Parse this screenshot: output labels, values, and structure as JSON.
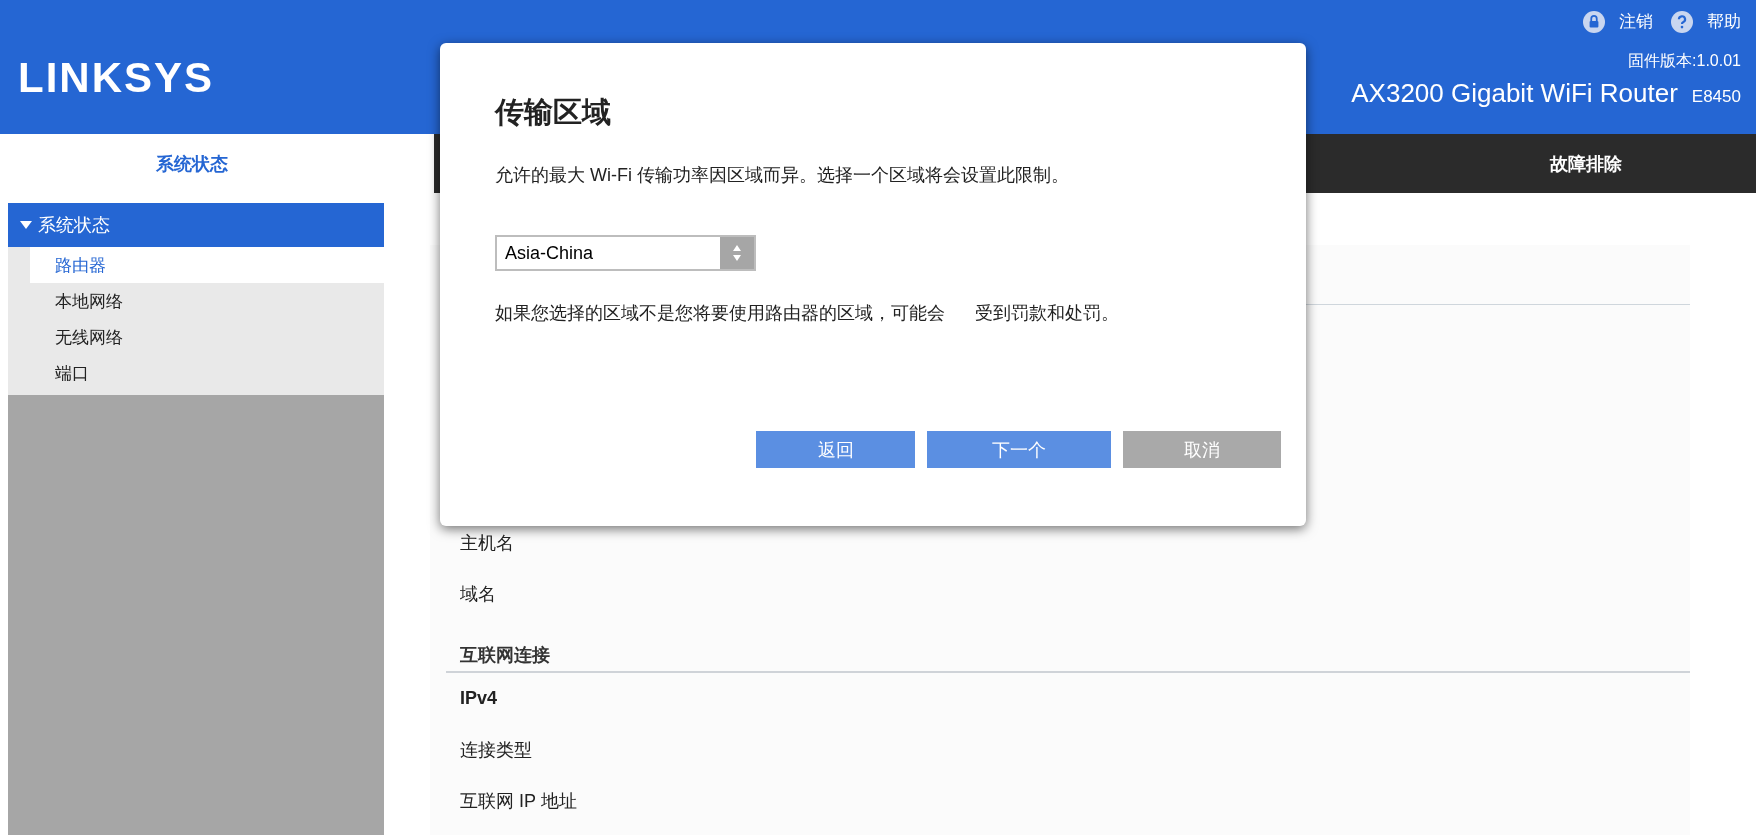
{
  "header": {
    "logo": "LINKSYS",
    "links": [
      {
        "kind": "logout",
        "label": "注销"
      },
      {
        "kind": "help",
        "label": "帮助"
      }
    ],
    "firmware": "固件版本:1.0.01",
    "product": "AX3200 Gigabit WiFi Router",
    "model": "E8450"
  },
  "sidebar": {
    "title": "系统状态",
    "section": {
      "label": "系统状态",
      "expanded": true,
      "children": [
        {
          "label": "路由器",
          "selected": true
        },
        {
          "label": "本地网络",
          "selected": false
        },
        {
          "label": "无线网络",
          "selected": false
        },
        {
          "label": "端口",
          "selected": false
        }
      ]
    }
  },
  "nav": {
    "tabs": [
      {
        "label": "故障排除",
        "selected": false
      }
    ]
  },
  "content": {
    "rows": [
      {
        "kind": "label",
        "text": "主机名"
      },
      {
        "kind": "label",
        "text": "域名"
      },
      {
        "kind": "heading",
        "text": "互联网连接"
      },
      {
        "kind": "subheading",
        "text": "IPv4"
      },
      {
        "kind": "label",
        "text": "连接类型"
      },
      {
        "kind": "label",
        "text": "互联网 IP 地址"
      }
    ]
  },
  "dialog": {
    "title": "传输区域",
    "description": "允许的最大 Wi-Fi 传输功率因区域而异。选择一个区域将会设置此限制。",
    "select": {
      "value": "Asia-China"
    },
    "warning": "如果您选择的区域不是您将要使用路由器的区域，可能会      受到罚款和处罚。",
    "buttons": [
      {
        "kind": "primary",
        "label": "返回"
      },
      {
        "kind": "primary",
        "label": "下一个"
      },
      {
        "kind": "secondary",
        "label": "取消"
      }
    ]
  }
}
